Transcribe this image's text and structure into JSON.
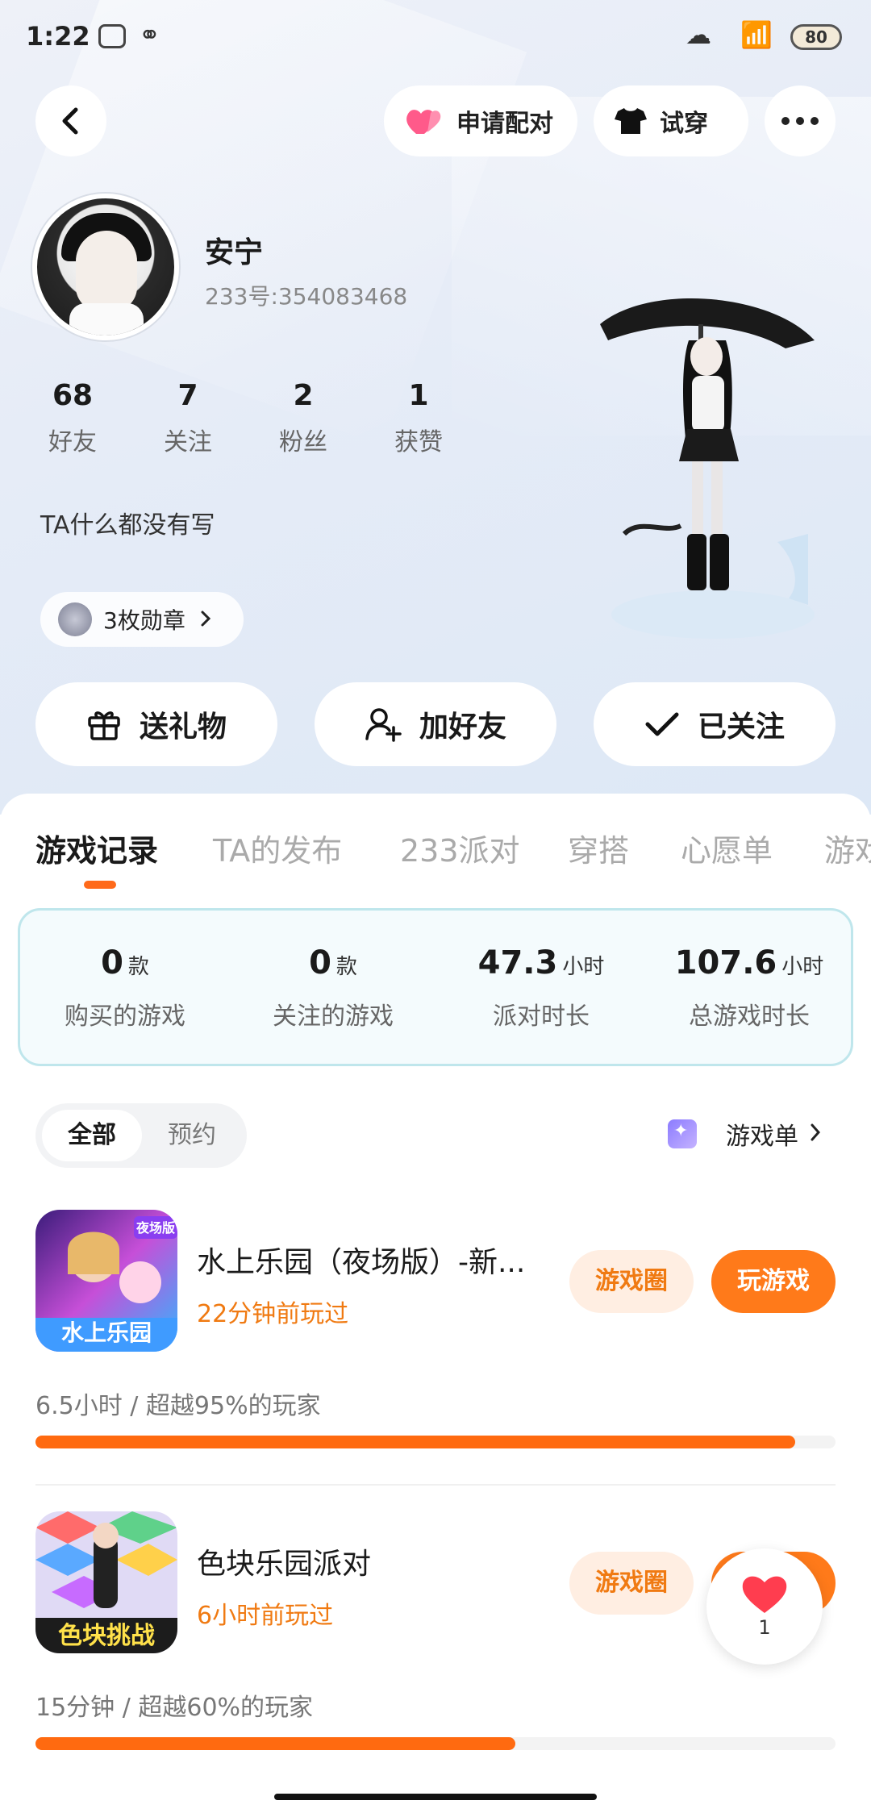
{
  "status_bar": {
    "time": "1:22",
    "battery": "80"
  },
  "nav": {
    "pair_label": "申请配对",
    "tryon_label": "试穿"
  },
  "profile": {
    "name": "安宁",
    "id": "233号:354083468",
    "stats": [
      {
        "num": "68",
        "label": "好友"
      },
      {
        "num": "7",
        "label": "关注"
      },
      {
        "num": "2",
        "label": "粉丝"
      },
      {
        "num": "1",
        "label": "获赞"
      }
    ],
    "bio": "TA什么都没有写",
    "medals": "3枚勋章"
  },
  "actions": {
    "gift": "送礼物",
    "add_friend": "加好友",
    "followed": "已关注"
  },
  "tabs": [
    "游戏记录",
    "TA的发布",
    "233派对",
    "穿搭",
    "心愿单",
    "游戏"
  ],
  "summary": [
    {
      "value": "0",
      "unit": "款",
      "label": "购买的游戏"
    },
    {
      "value": "0",
      "unit": "款",
      "label": "关注的游戏"
    },
    {
      "value": "47.3",
      "unit": "小时",
      "label": "派对时长"
    },
    {
      "value": "107.6",
      "unit": "小时",
      "label": "总游戏时长"
    }
  ],
  "filter": {
    "all": "全部",
    "reserve": "预约"
  },
  "game_list_link": "游戏单",
  "games": [
    {
      "title": "水上乐园（夜场版）-新...",
      "last_played": "22分钟前玩过",
      "circle_label": "游戏圈",
      "play_label": "玩游戏",
      "play_stat": "6.5小时 / 超越95%的玩家",
      "progress": 0.95,
      "icon_text": "水上乐园",
      "icon_tag": "夜场版"
    },
    {
      "title": "色块乐园派对",
      "last_played": "6小时前玩过",
      "circle_label": "游戏圈",
      "play_stat": "15分钟 / 超越60%的玩家",
      "progress": 0.6,
      "icon_text": "色块挑战"
    }
  ],
  "like_count": "1",
  "colors": {
    "accent": "#ff6a10",
    "accent_text": "#f07a12"
  }
}
